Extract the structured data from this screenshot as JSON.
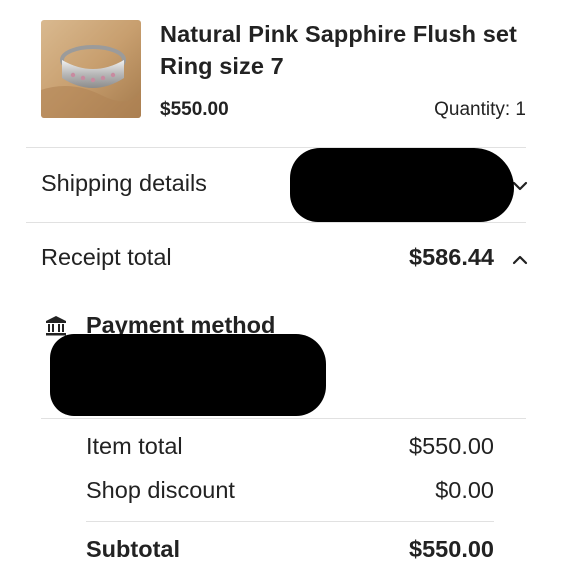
{
  "product": {
    "title": "Natural Pink Sapphire Flush set Ring  size 7",
    "price": "$550.00",
    "quantity": "Quantity: 1",
    "thumbnail_icon": "ring-photo"
  },
  "shipping": {
    "label": "Shipping details",
    "chevron_icon": "chevron-down-icon"
  },
  "receipt": {
    "label": "Receipt total",
    "total": "$586.44",
    "chevron_icon": "chevron-up-icon"
  },
  "payment": {
    "icon": "bank-icon",
    "label": "Payment method"
  },
  "summary": {
    "item_total_label": "Item total",
    "item_total_value": "$550.00",
    "shop_discount_label": "Shop discount",
    "shop_discount_value": "$0.00",
    "subtotal_label": "Subtotal",
    "subtotal_value": "$550.00"
  },
  "colors": {
    "text": "#222222",
    "divider": "#e1e1e1",
    "redaction": "#000000"
  }
}
